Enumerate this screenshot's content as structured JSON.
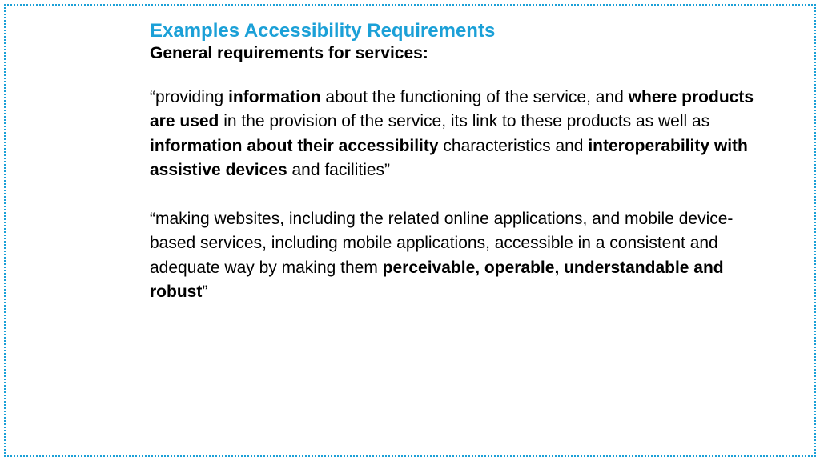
{
  "title": "Examples Accessibility Requirements",
  "subtitle": "General requirements for services:",
  "p1": {
    "s1": "“providing ",
    "b1": "information",
    "s2": " about the functioning of the service, and ",
    "b2": "where products are used",
    "s3": " in the provision of the service, its link to these products as well as ",
    "b3": "information about their accessibility",
    "s4": " characteristics and ",
    "b4": "interoperability with assistive devices",
    "s5": " and facilities”"
  },
  "p2": {
    "s1": "“making websites, including the related online applications, and mobile device-based services, including mobile applications, accessible in a consistent and adequate way by making them ",
    "b1": "perceivable, operable, understandable and robust",
    "s2": "”"
  }
}
